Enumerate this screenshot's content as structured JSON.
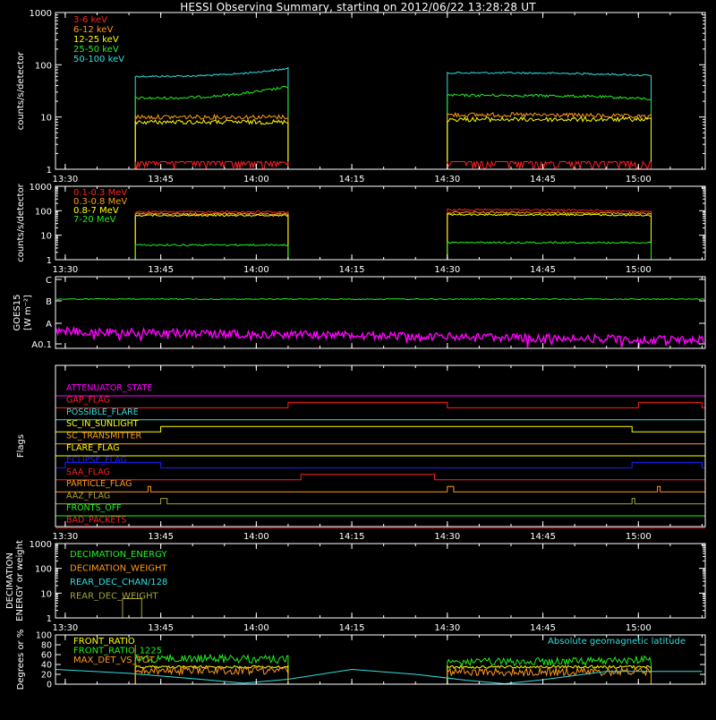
{
  "title": "HESSI Observing Summary, starting on 2012/06/22 13:28:28 UT",
  "colors": {
    "red": "#ff2020",
    "orange": "#ff9a1a",
    "yellow": "#ffff00",
    "green": "#22ee22",
    "cyan": "#33dddd",
    "magenta": "#ff00ff",
    "blue": "#1e1eff",
    "olive": "#a7a23a",
    "white": "#ffffff"
  },
  "time_ticks": [
    "13:30",
    "13:45",
    "14:00",
    "14:15",
    "14:30",
    "14:45",
    "15:00"
  ],
  "chart_data": [
    {
      "type": "line",
      "id": "p1",
      "ylabel": "counts/s/detector",
      "y_scale": "log",
      "ylim": [
        1,
        1000
      ],
      "y_ticks": [
        "1",
        "10",
        "100",
        "1000"
      ],
      "legend": [
        {
          "name": "3-6 keV",
          "color": "red"
        },
        {
          "name": "6-12 keV",
          "color": "orange"
        },
        {
          "name": "12-25 keV",
          "color": "yellow"
        },
        {
          "name": "25-50 keV",
          "color": "green"
        },
        {
          "name": "50-100 keV",
          "color": "cyan"
        }
      ],
      "series": [
        {
          "name": "50-100 keV",
          "color": "cyan",
          "segments": [
            {
              "t0": "13:41",
              "t1": "14:05",
              "v0": 60,
              "v1": 85
            },
            {
              "t0": "14:30",
              "t1": "15:02",
              "v0": 70,
              "v1": 62
            }
          ]
        },
        {
          "name": "25-50 keV",
          "color": "green",
          "segments": [
            {
              "t0": "13:41",
              "t1": "14:05",
              "v0": 23,
              "v1": 38
            },
            {
              "t0": "14:30",
              "t1": "15:02",
              "v0": 26,
              "v1": 22
            }
          ]
        },
        {
          "name": "6-12 keV",
          "color": "orange",
          "segments": [
            {
              "t0": "13:41",
              "t1": "14:05",
              "v0": 10,
              "v1": 10
            },
            {
              "t0": "14:30",
              "t1": "15:02",
              "v0": 11,
              "v1": 10
            }
          ]
        },
        {
          "name": "12-25 keV",
          "color": "yellow",
          "segments": [
            {
              "t0": "13:41",
              "t1": "14:05",
              "v0": 8,
              "v1": 8
            },
            {
              "t0": "14:30",
              "t1": "15:02",
              "v0": 9,
              "v1": 9
            }
          ]
        },
        {
          "name": "3-6 keV",
          "color": "red",
          "segments": [
            {
              "t0": "13:41",
              "t1": "14:05",
              "v0": 1.4,
              "v1": 1.4
            },
            {
              "t0": "14:30",
              "t1": "15:02",
              "v0": 1.4,
              "v1": 1.4
            }
          ]
        }
      ]
    },
    {
      "type": "line",
      "id": "p2",
      "ylabel": "counts/s/detector",
      "y_scale": "log",
      "ylim": [
        1,
        1000
      ],
      "y_ticks": [
        "1",
        "10",
        "100",
        "1000"
      ],
      "legend": [
        {
          "name": "0.1-0.3 MeV",
          "color": "red"
        },
        {
          "name": "0.3-0.8 MeV",
          "color": "orange"
        },
        {
          "name": "0.8-7 MeV",
          "color": "yellow"
        },
        {
          "name": "7-20 MeV",
          "color": "green"
        }
      ],
      "series": [
        {
          "name": "0.1-0.3 MeV",
          "color": "red",
          "segments": [
            {
              "t0": "13:41",
              "t1": "14:05",
              "v0": 90,
              "v1": 90
            },
            {
              "t0": "14:30",
              "t1": "15:02",
              "v0": 110,
              "v1": 90
            }
          ]
        },
        {
          "name": "0.3-0.8 MeV",
          "color": "orange",
          "segments": [
            {
              "t0": "13:41",
              "t1": "14:05",
              "v0": 75,
              "v1": 75
            },
            {
              "t0": "14:30",
              "t1": "15:02",
              "v0": 85,
              "v1": 75
            }
          ]
        },
        {
          "name": "0.8-7 MeV",
          "color": "yellow",
          "segments": [
            {
              "t0": "13:41",
              "t1": "14:05",
              "v0": 65,
              "v1": 65
            },
            {
              "t0": "14:30",
              "t1": "15:02",
              "v0": 70,
              "v1": 65
            }
          ]
        },
        {
          "name": "7-20 MeV",
          "color": "green",
          "segments": [
            {
              "t0": "13:41",
              "t1": "14:05",
              "v0": 4,
              "v1": 4
            },
            {
              "t0": "14:30",
              "t1": "15:02",
              "v0": 5,
              "v1": 5
            }
          ]
        }
      ]
    },
    {
      "type": "line",
      "id": "p3",
      "ylabel": "GOES15 [W m⁻²]",
      "y_ticks": [
        "A0.1",
        "A",
        "B",
        "C"
      ],
      "series": [
        {
          "name": "",
          "color": "green",
          "level": "B",
          "level_offset": -0.1
        },
        {
          "name": "",
          "color": "magenta",
          "level": "A",
          "level_offset": -0.3,
          "level_end_offset": -0.65
        }
      ]
    },
    {
      "type": "line",
      "id": "p4",
      "ylabel": "Flags",
      "flags": [
        {
          "name": "ATTENUATOR_STATE",
          "color": "magenta",
          "high": []
        },
        {
          "name": "GAP_FLAG",
          "color": "red",
          "high": [
            [
              "14:05",
              "14:30"
            ],
            [
              "15:00",
              "15:10"
            ]
          ]
        },
        {
          "name": "POSSIBLE_FLARE",
          "color": "cyan",
          "high": []
        },
        {
          "name": "SC_IN_SUNLIGHT",
          "color": "yellow",
          "high": [
            [
              "13:45",
              "14:59"
            ]
          ]
        },
        {
          "name": "SC_TRANSMITTER",
          "color": "orange",
          "high": []
        },
        {
          "name": "FLARE_FLAG",
          "color": "yellow",
          "high": []
        },
        {
          "name": "ECLIPSE_FLAG",
          "color": "blue",
          "high": [
            [
              "13:30",
              "13:45"
            ],
            [
              "14:59",
              "15:10"
            ]
          ]
        },
        {
          "name": "SAA_FLAG",
          "color": "red",
          "high": [
            [
              "14:07",
              "14:28"
            ]
          ]
        },
        {
          "name": "PARTICLE_FLAG",
          "color": "orange",
          "high": [
            [
              "13:43",
              "13:43"
            ],
            [
              "14:30",
              "14:31"
            ],
            [
              "15:03",
              "15:03"
            ]
          ]
        },
        {
          "name": "AAZ_FLAG",
          "color": "olive",
          "high": [
            [
              "13:45",
              "13:46"
            ],
            [
              "14:59",
              "14:59"
            ]
          ]
        },
        {
          "name": "FRONTS_OFF",
          "color": "green",
          "high": []
        },
        {
          "name": "BAD_PACKETS",
          "color": "red",
          "high": []
        }
      ]
    },
    {
      "type": "line",
      "id": "p5",
      "ylabel": "DECIMATION ENERGY or weight",
      "y_scale": "log",
      "ylim": [
        1,
        1000
      ],
      "y_ticks": [
        "1",
        "10",
        "100",
        "1000"
      ],
      "legend": [
        {
          "name": "DECIMATION_ENERGY",
          "color": "green"
        },
        {
          "name": "DECIMATION_WEIGHT",
          "color": "orange"
        },
        {
          "name": "REAR_DEC_CHAN/128",
          "color": "cyan"
        },
        {
          "name": "REAR_DEC_WEIGHT",
          "color": "olive"
        }
      ],
      "series": [
        {
          "name": "REAR_DEC_WEIGHT",
          "color": "olive",
          "segments": [
            {
              "t0": "13:39",
              "t1": "13:42",
              "v0": 6,
              "v1": 6
            }
          ]
        }
      ]
    },
    {
      "type": "line",
      "id": "p6",
      "ylabel": "Degrees or %",
      "ylim": [
        0,
        100
      ],
      "y_ticks": [
        "0",
        "20",
        "40",
        "60",
        "80",
        "100"
      ],
      "legend": [
        {
          "name": "FRONT_RATIO",
          "color": "yellow"
        },
        {
          "name": "FRONT_RATIO_1225",
          "color": "green"
        },
        {
          "name": "MAX_DET_VS_TOT",
          "color": "orange"
        }
      ],
      "legend_right": {
        "name": "Absolute geomagnetic latitude",
        "color": "cyan"
      },
      "series": [
        {
          "name": "FRONT_RATIO_1225",
          "color": "green",
          "segments": [
            {
              "t0": "13:41",
              "t1": "14:05",
              "v0": 52,
              "v1": 50
            },
            {
              "t0": "14:30",
              "t1": "15:02",
              "v0": 45,
              "v1": 50
            }
          ]
        },
        {
          "name": "FRONT_RATIO",
          "color": "yellow",
          "segments": [
            {
              "t0": "13:41",
              "t1": "14:05",
              "v0": 35,
              "v1": 35
            },
            {
              "t0": "14:30",
              "t1": "15:02",
              "v0": 35,
              "v1": 35
            }
          ]
        },
        {
          "name": "MAX_DET_VS_TOT",
          "color": "orange",
          "segments": [
            {
              "t0": "13:41",
              "t1": "14:05",
              "v0": 28,
              "v1": 28
            },
            {
              "t0": "14:30",
              "t1": "15:02",
              "v0": 25,
              "v1": 25
            }
          ]
        },
        {
          "name": "Absolute geomagnetic latitude",
          "color": "cyan",
          "path": [
            [
              "13:28",
              30
            ],
            [
              "13:40",
              22
            ],
            [
              "13:52",
              9
            ],
            [
              "13:58",
              2
            ],
            [
              "14:05",
              10
            ],
            [
              "14:15",
              30
            ],
            [
              "14:25",
              20
            ],
            [
              "14:33",
              8
            ],
            [
              "14:39",
              1
            ],
            [
              "14:45",
              9
            ],
            [
              "14:55",
              26
            ],
            [
              "15:10",
              26
            ]
          ]
        }
      ]
    }
  ]
}
